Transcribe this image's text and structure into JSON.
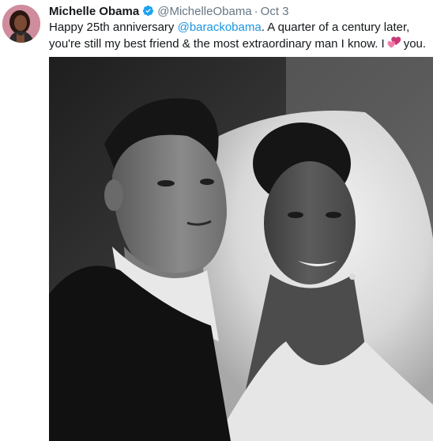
{
  "tweet": {
    "author_name": "Michelle Obama",
    "author_handle": "@MichelleObama",
    "separator": "·",
    "date": "Oct 3",
    "text_before_mention": "Happy 25th anniversary ",
    "mention": "@barackobama",
    "text_after_mention": ". A quarter of a century later, you're still my best friend & the most extraordinary man I know. I",
    "text_end": "you.",
    "emoji": "two-hearts-icon"
  },
  "colors": {
    "name": "#14171a",
    "secondary": "#657786",
    "link": "#1b95e0",
    "verified": "#1da1f2",
    "heart": "#e8478b"
  },
  "photo": {
    "description_icon": "wedding-photo",
    "style": "black-and-white"
  }
}
